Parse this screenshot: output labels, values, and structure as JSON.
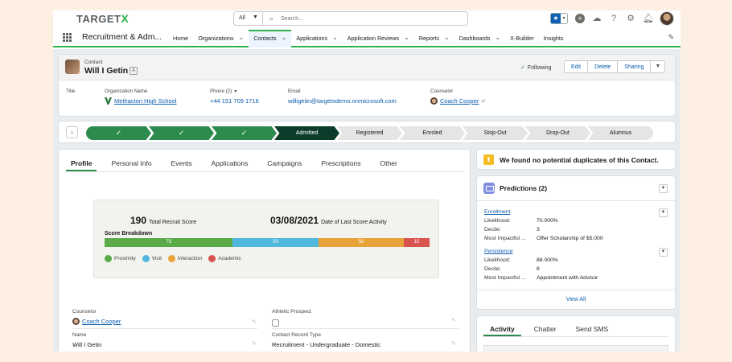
{
  "brand": {
    "logo_text": "TARGET",
    "logo_mark": "X"
  },
  "search": {
    "scope": "All",
    "placeholder": "Search..."
  },
  "nav": {
    "app_name": "Recruitment & Adm...",
    "items": [
      {
        "label": "Home",
        "chevron": false
      },
      {
        "label": "Organizations",
        "chevron": true
      },
      {
        "label": "Contacts",
        "chevron": true,
        "active": true
      },
      {
        "label": "Applications",
        "chevron": true
      },
      {
        "label": "Application Reviews",
        "chevron": true
      },
      {
        "label": "Reports",
        "chevron": true
      },
      {
        "label": "Dashboards",
        "chevron": true
      },
      {
        "label": "X-Builder",
        "chevron": false
      },
      {
        "label": "Insights",
        "chevron": false
      }
    ]
  },
  "record": {
    "object_label": "Contact",
    "name": "Will I Getin",
    "following_label": "Following",
    "buttons": [
      "Edit",
      "Delete",
      "Sharing"
    ],
    "fields": {
      "title_label": "Title",
      "org_label": "Organization Name",
      "org_value": "Methacton High School",
      "phone_label": "Phone (2)",
      "phone_value": "+44 151 709 1716",
      "email_label": "Email",
      "email_value": "willigetin@targetxdemo.onmicrosoft.com",
      "counselor_label": "Counselor",
      "counselor_value": "Coach Cooper"
    }
  },
  "path": {
    "stages": [
      {
        "label": "✓",
        "state": "done"
      },
      {
        "label": "✓",
        "state": "done"
      },
      {
        "label": "✓",
        "state": "done"
      },
      {
        "label": "Admitted",
        "state": "current"
      },
      {
        "label": "Registered",
        "state": "todo"
      },
      {
        "label": "Enroled",
        "state": "todo"
      },
      {
        "label": "Stop-Out",
        "state": "todo"
      },
      {
        "label": "Drop-Out",
        "state": "todo"
      },
      {
        "label": "Alumnus",
        "state": "todo"
      }
    ]
  },
  "profile_tabs": [
    "Profile",
    "Personal Info",
    "Events",
    "Applications",
    "Campaigns",
    "Prescriptions",
    "Other"
  ],
  "score": {
    "total": "190",
    "total_label": "Total Recruit Score",
    "date": "03/08/2021",
    "date_label": "Date of Last Score Activity",
    "breakdown_label": "Score Breakdown",
    "segments": [
      {
        "name": "Proximity",
        "value": 75,
        "color": "#5aaa4a"
      },
      {
        "name": "Visit",
        "value": 50,
        "color": "#4fb8dc"
      },
      {
        "name": "Interaction",
        "value": 50,
        "color": "#e8a23a"
      },
      {
        "name": "Academic",
        "value": 15,
        "color": "#d9534f"
      }
    ]
  },
  "details": {
    "counselor_label": "Counselor",
    "counselor_value": "Coach Cooper",
    "athletic_label": "Athletic Prospect",
    "name_label": "Name",
    "name_value": "Will I Getin",
    "record_type_label": "Contact Record Type",
    "record_type_value": "Recruitment - Undergraduate - Domestic"
  },
  "duplicates": {
    "text": "We found no potential duplicates of this Contact."
  },
  "predictions": {
    "title": "Predictions (2)",
    "items": [
      {
        "name": "Enrollment",
        "likelihood": "70.000%",
        "decile": "3",
        "factor": "Offer Scholarship of $5,000"
      },
      {
        "name": "Persistence",
        "likelihood": "88.000%",
        "decile": "8",
        "factor": "Appointment with Advisor"
      }
    ],
    "likelihood_label": "Likelihood:",
    "decile_label": "Decile:",
    "factor_label": "Most Impactful ...",
    "view_all": "View All"
  },
  "activity": {
    "tabs": [
      "Activity",
      "Chatter",
      "Send SMS"
    ]
  }
}
